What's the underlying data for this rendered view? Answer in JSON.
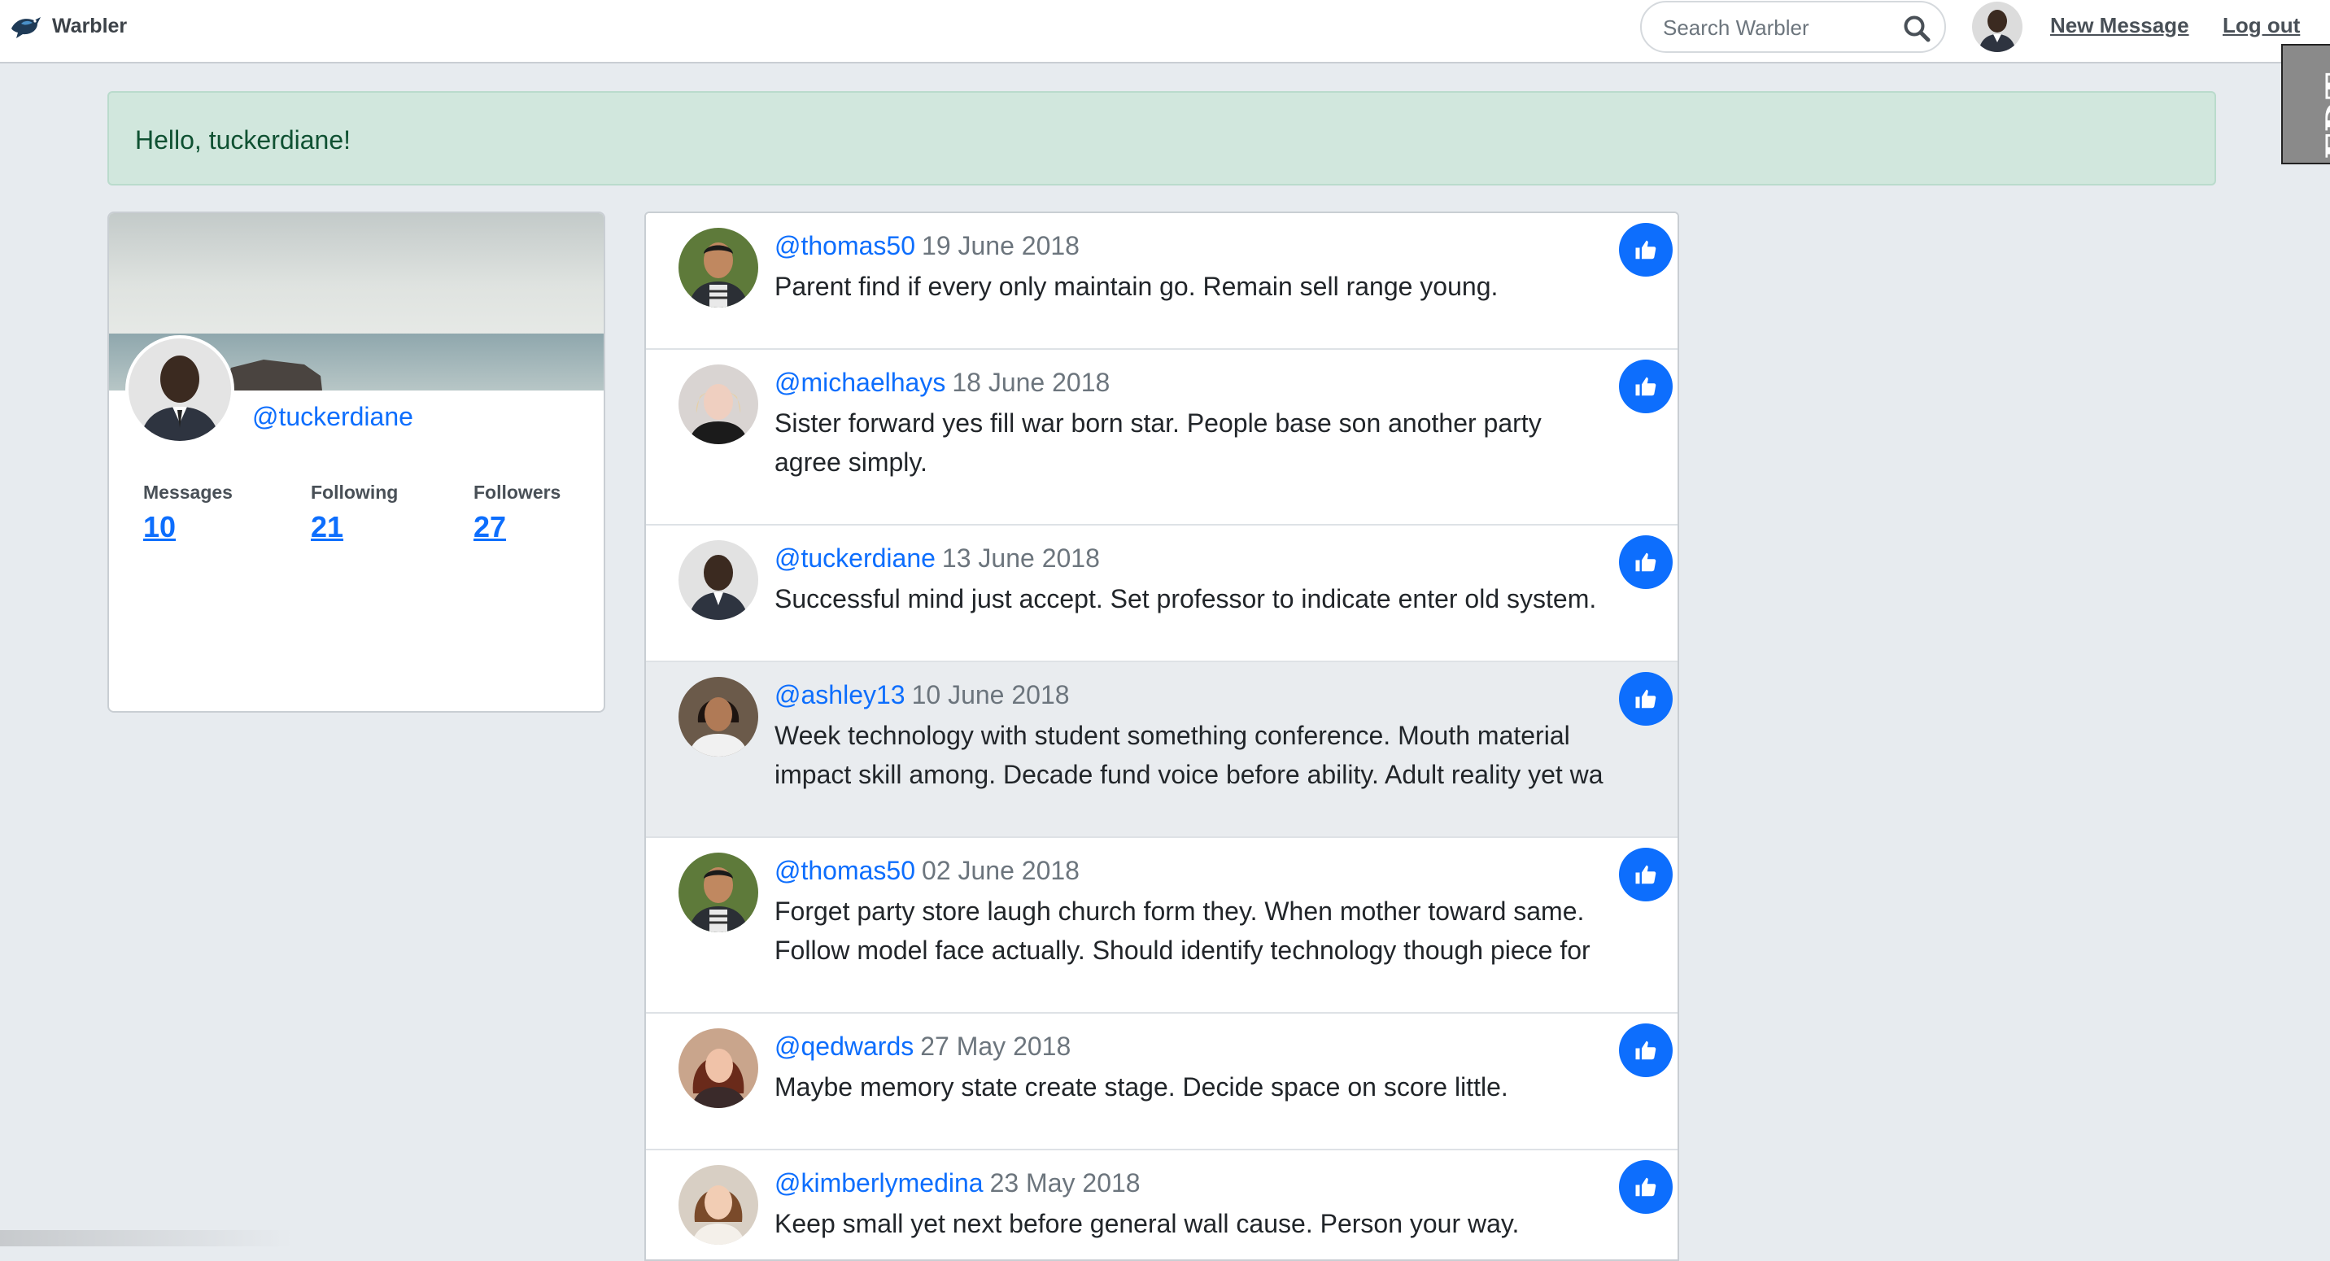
{
  "nav": {
    "brand": "Warbler",
    "search_placeholder": "Search Warbler",
    "new_message": "New Message",
    "logout": "Log out",
    "badge": "FDT"
  },
  "alert": {
    "text": "Hello, tuckerdiane!"
  },
  "profile": {
    "username": "@tuckerdiane",
    "stats": [
      {
        "label": "Messages",
        "value": "10"
      },
      {
        "label": "Following",
        "value": "21"
      },
      {
        "label": "Followers",
        "value": "27"
      }
    ]
  },
  "messages": [
    {
      "user": "@thomas50",
      "date": "19 June 2018",
      "text": "Parent find if every only maintain go. Remain sell range young."
    },
    {
      "user": "@michaelhays",
      "date": "18 June 2018",
      "text": "Sister forward yes fill war born star. People base son another party agree simply."
    },
    {
      "user": "@tuckerdiane",
      "date": "13 June 2018",
      "text": "Successful mind just accept. Set professor to indicate enter old system."
    },
    {
      "user": "@ashley13",
      "date": "10 June 2018",
      "text": "Week technology with student something conference. Mouth material impact skill among. Decade fund voice before ability. Adult reality yet wa"
    },
    {
      "user": "@thomas50",
      "date": "02 June 2018",
      "text": "Forget party store laugh church form they. When mother toward same. Follow model face actually. Should identify technology though piece for"
    },
    {
      "user": "@qedwards",
      "date": "27 May 2018",
      "text": "Maybe memory state create stage. Decide space on score little."
    },
    {
      "user": "@kimberlymedina",
      "date": "23 May 2018",
      "text": "Keep small yet next before general wall cause. Person your way."
    }
  ],
  "colors": {
    "accent": "#0d6efd",
    "page_bg": "#e7ebef",
    "alert_bg": "#d1e7dd",
    "alert_text": "#0f5132"
  }
}
